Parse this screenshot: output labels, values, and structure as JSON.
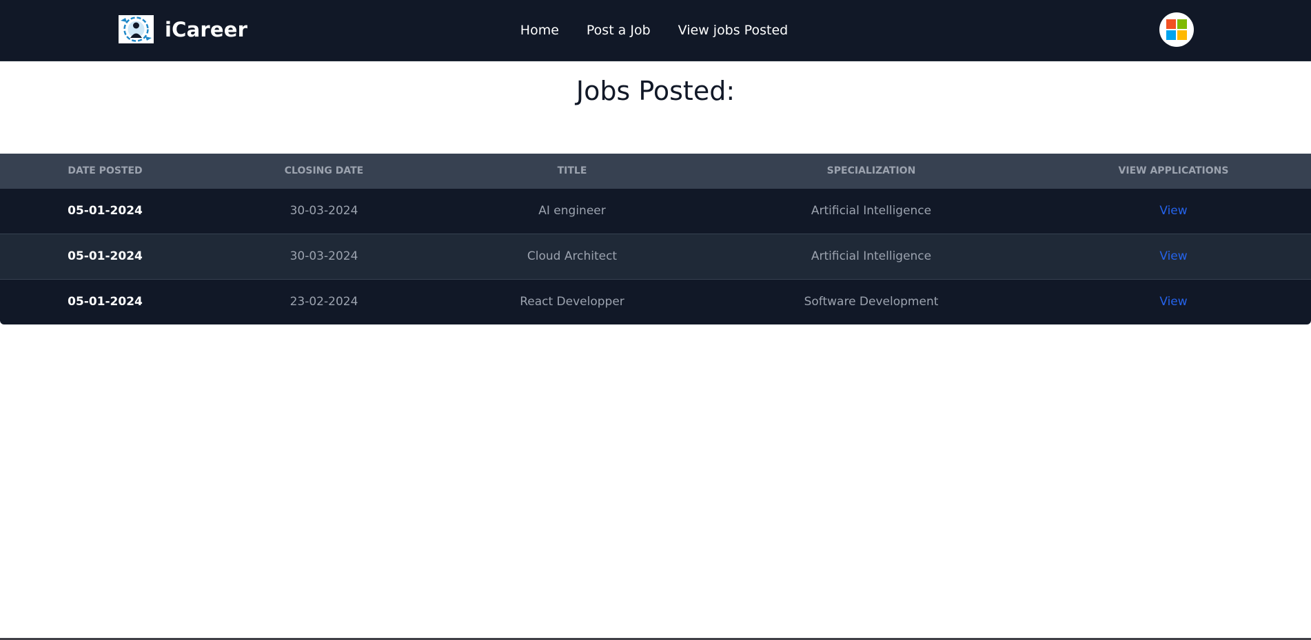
{
  "navbar": {
    "brand_name": "iCareer",
    "links": {
      "home": "Home",
      "post_job": "Post a Job",
      "view_jobs": "View jobs Posted"
    },
    "user_icon": "microsoft-logo-icon"
  },
  "main": {
    "heading": "Jobs Posted:"
  },
  "table": {
    "headers": {
      "date_posted": "Date Posted",
      "closing_date": "Closing Date",
      "title": "Title",
      "specialization": "Specialization",
      "view_applications": "View Applications"
    },
    "rows": [
      {
        "date_posted": "05-01-2024",
        "closing_date": "30-03-2024",
        "title": "AI engineer",
        "specialization": "Artificial Intelligence",
        "view": "View"
      },
      {
        "date_posted": "05-01-2024",
        "closing_date": "30-03-2024",
        "title": "Cloud Architect",
        "specialization": "Artificial Intelligence",
        "view": "View"
      },
      {
        "date_posted": "05-01-2024",
        "closing_date": "23-02-2024",
        "title": "React Developper",
        "specialization": "Software Development",
        "view": "View"
      }
    ]
  },
  "colors": {
    "navbar_bg": "#111827",
    "table_header_bg": "#374151",
    "row_odd_bg": "#111827",
    "row_even_bg": "#1f2937",
    "link_blue": "#2563eb",
    "ms_red": "#f25022",
    "ms_green": "#7fba00",
    "ms_blue": "#00a4ef",
    "ms_yellow": "#ffb900"
  }
}
